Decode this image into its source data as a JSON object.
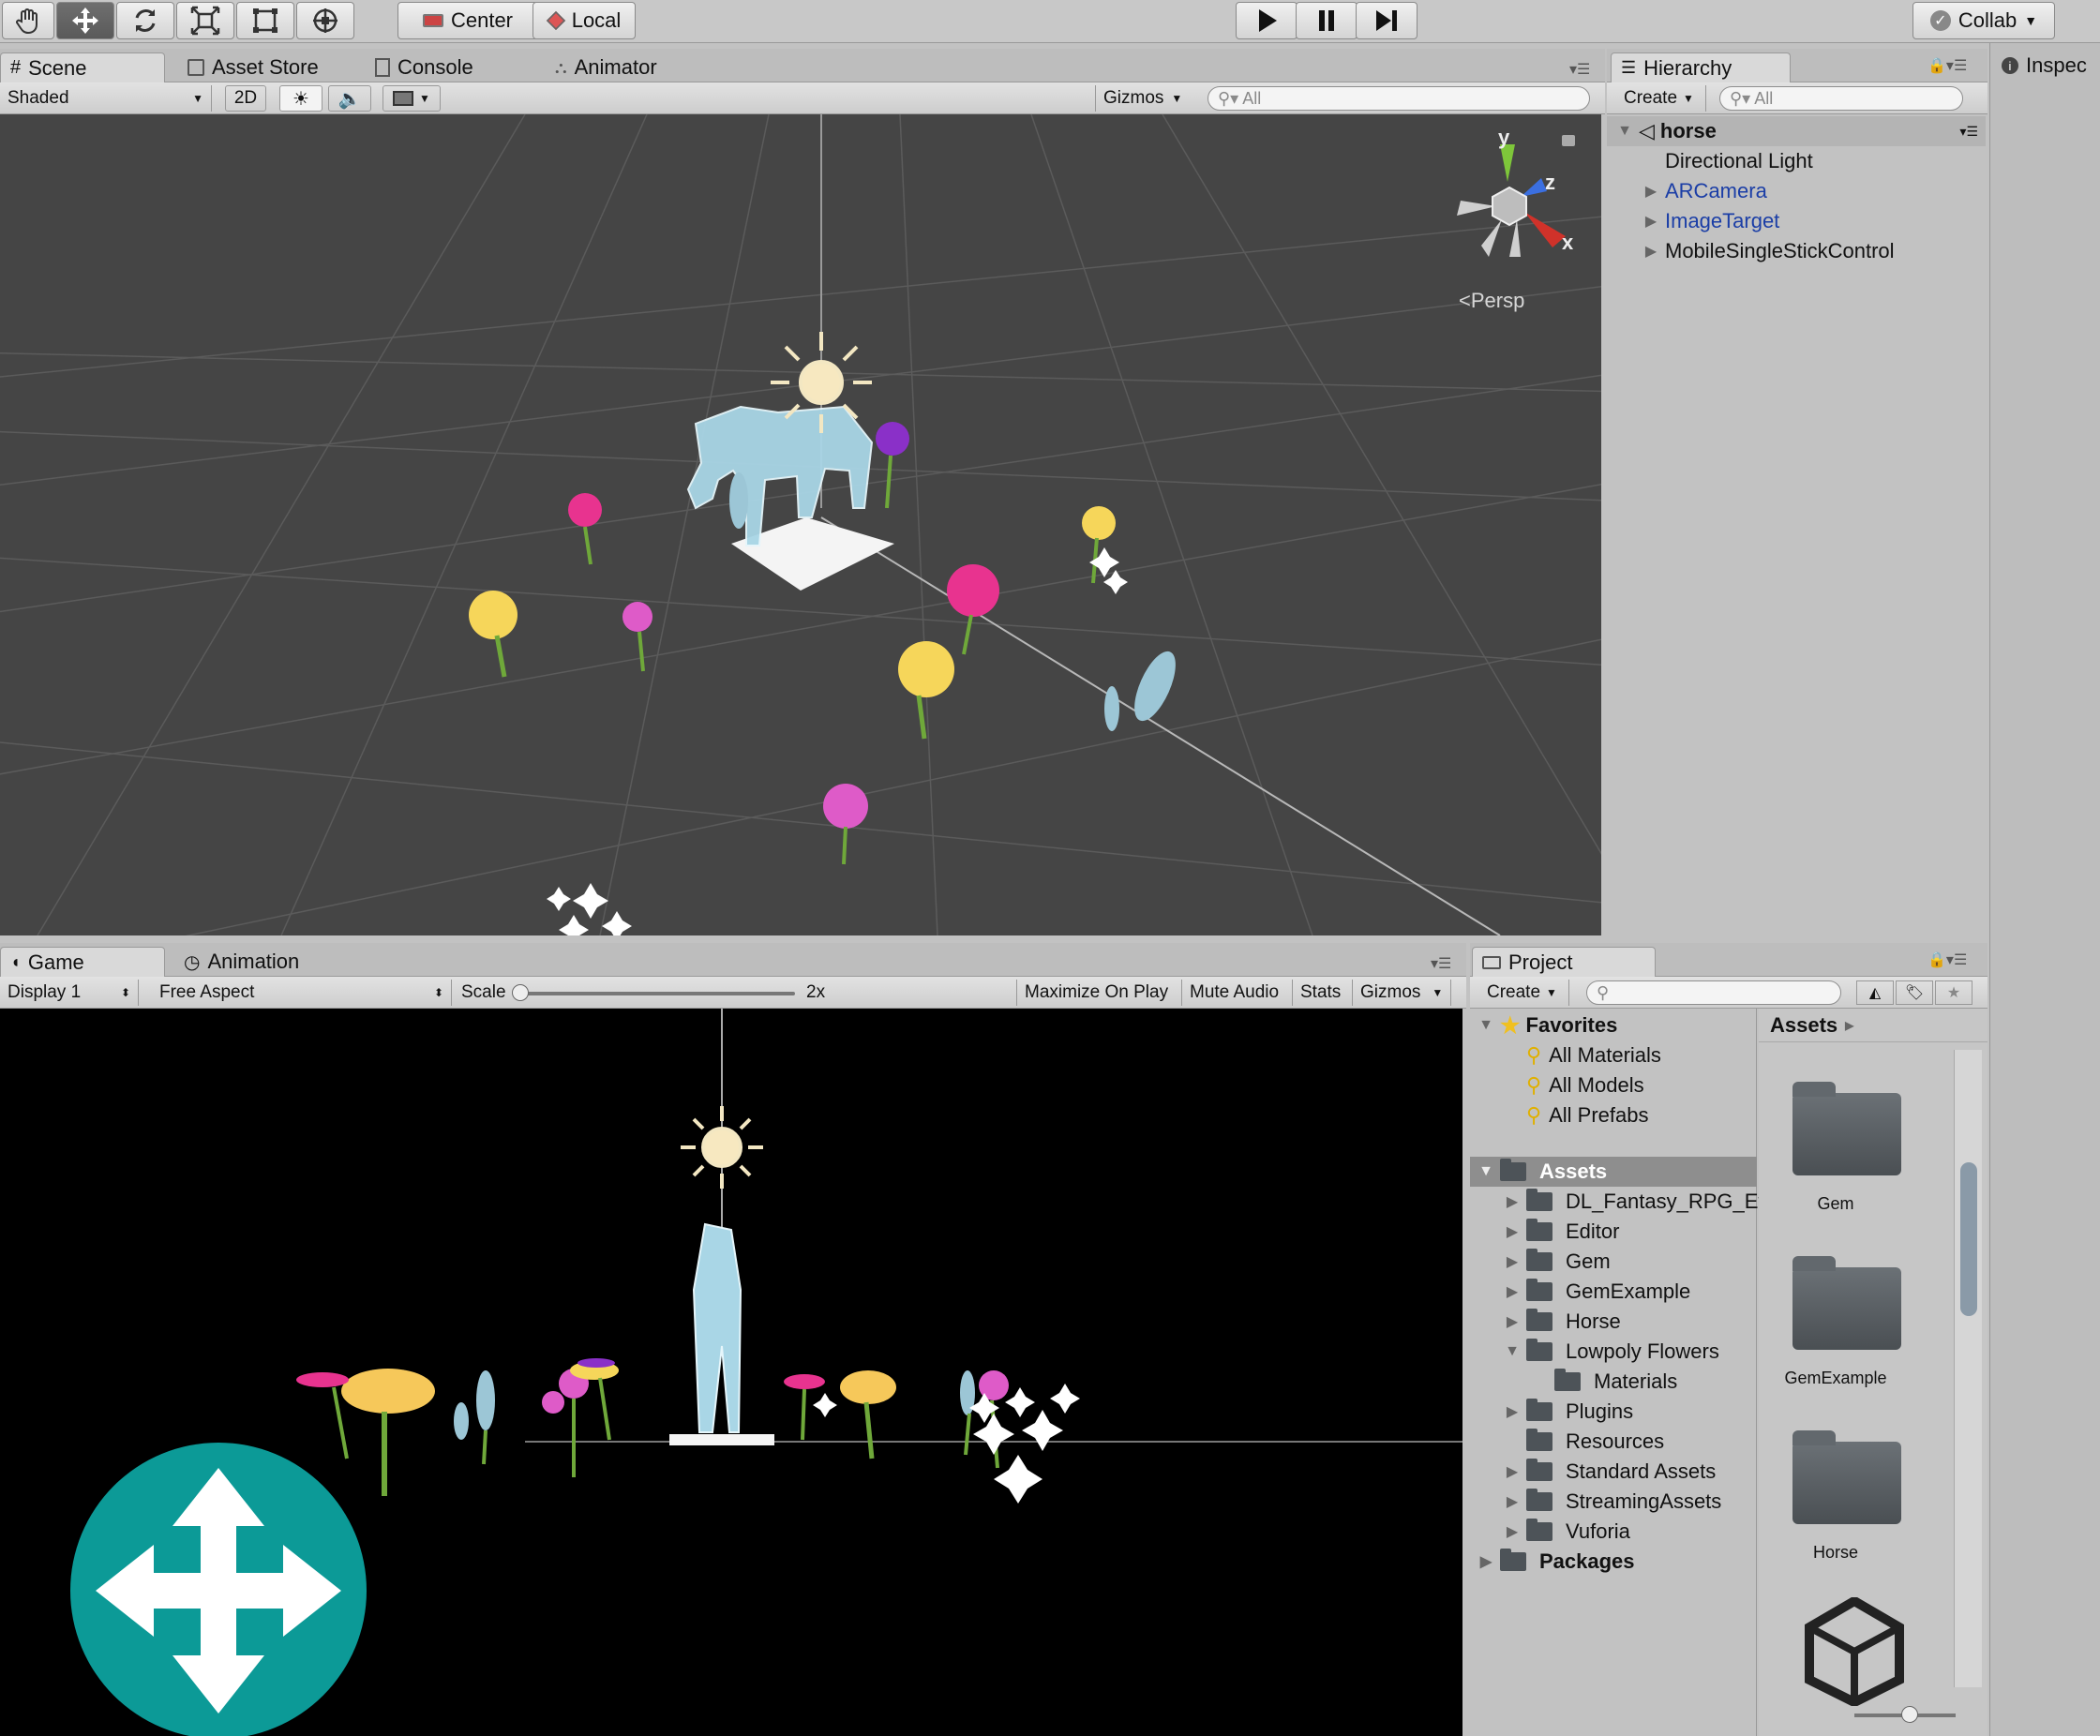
{
  "toolbar": {
    "pivot_label": "Center",
    "space_label": "Local",
    "collab_label": "Collab"
  },
  "scene_tabs": [
    {
      "label": "Scene"
    },
    {
      "label": "Asset Store"
    },
    {
      "label": "Console"
    },
    {
      "label": "Animator"
    }
  ],
  "scene_bar": {
    "shading_mode": "Shaded",
    "two_d_label": "2D",
    "gizmos_label": "Gizmos",
    "search_placeholder": "All"
  },
  "scene_view": {
    "persp_label": "Persp",
    "axis_y": "y",
    "axis_z": "z",
    "axis_x": "x",
    "axis_colors": {
      "x": "#d0322a",
      "y": "#7ec63a",
      "z": "#3b6fe0"
    }
  },
  "hierarchy": {
    "tab_label": "Hierarchy",
    "create_label": "Create",
    "search_placeholder": "All",
    "scene_name": "horse",
    "items": [
      {
        "label": "Directional Light",
        "prefab": false
      },
      {
        "label": "ARCamera",
        "prefab": true
      },
      {
        "label": "ImageTarget",
        "prefab": true
      },
      {
        "label": "MobileSingleStickControl",
        "prefab": false
      }
    ],
    "prefab_color": "#1b3ea6"
  },
  "inspector": {
    "tab_label": "Inspec"
  },
  "game_tabs": [
    {
      "label": "Game"
    },
    {
      "label": "Animation"
    }
  ],
  "game_bar": {
    "display": "Display 1",
    "aspect": "Free Aspect",
    "scale_label": "Scale",
    "scale_value": "2x",
    "maximize": "Maximize On Play",
    "mute": "Mute Audio",
    "stats": "Stats",
    "gizmos": "Gizmos"
  },
  "project": {
    "tab_label": "Project",
    "create_label": "Create",
    "favorites_label": "Favorites",
    "favorites": [
      "All Materials",
      "All Models",
      "All Prefabs"
    ],
    "assets_label": "Assets",
    "asset_folders": [
      {
        "label": "DL_Fantasy_RPG_Eff",
        "level": 1
      },
      {
        "label": "Editor",
        "level": 1
      },
      {
        "label": "Gem",
        "level": 1
      },
      {
        "label": "GemExample",
        "level": 1
      },
      {
        "label": "Horse",
        "level": 1
      },
      {
        "label": "Lowpoly Flowers",
        "level": 1
      },
      {
        "label": "Materials",
        "level": 2
      },
      {
        "label": "Plugins",
        "level": 1
      },
      {
        "label": "Resources",
        "level": 1
      },
      {
        "label": "Standard Assets",
        "level": 1
      },
      {
        "label": "StreamingAssets",
        "level": 1
      },
      {
        "label": "Vuforia",
        "level": 1
      }
    ],
    "packages_label": "Packages",
    "breadcrumb": "Assets",
    "grid_items": [
      "Gem",
      "GemExample",
      "Horse"
    ]
  },
  "joystick_color": "#0c9a97"
}
